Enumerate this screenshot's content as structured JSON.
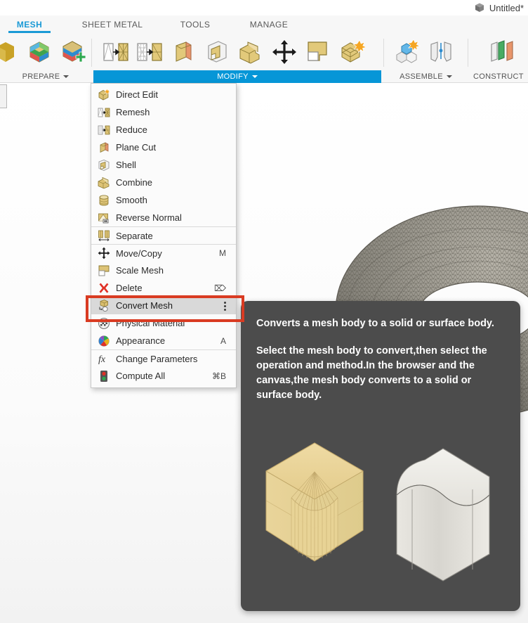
{
  "titlebar": {
    "document_name": "Untitled*",
    "doc_icon": "cube-icon"
  },
  "tabs": [
    {
      "label": "MESH",
      "active": true
    },
    {
      "label": "SHEET METAL",
      "active": false
    },
    {
      "label": "TOOLS",
      "active": false
    },
    {
      "label": "MANAGE",
      "active": false
    }
  ],
  "panels": [
    {
      "label": "PREPARE",
      "has_caret": true,
      "active": false
    },
    {
      "label": "MODIFY",
      "has_caret": true,
      "active": true
    },
    {
      "label": "ASSEMBLE",
      "has_caret": true,
      "active": false
    },
    {
      "label": "CONSTRUCT",
      "has_caret": false,
      "active": false
    }
  ],
  "menu": {
    "items": [
      {
        "label": "Direct Edit",
        "shortcut": "",
        "icon": "direct-edit-icon",
        "separator_above": false,
        "selected": false
      },
      {
        "label": "Remesh",
        "shortcut": "",
        "icon": "remesh-icon",
        "separator_above": false,
        "selected": false
      },
      {
        "label": "Reduce",
        "shortcut": "",
        "icon": "reduce-icon",
        "separator_above": false,
        "selected": false
      },
      {
        "label": "Plane Cut",
        "shortcut": "",
        "icon": "plane-cut-icon",
        "separator_above": false,
        "selected": false
      },
      {
        "label": "Shell",
        "shortcut": "",
        "icon": "shell-icon",
        "separator_above": false,
        "selected": false
      },
      {
        "label": "Combine",
        "shortcut": "",
        "icon": "combine-icon",
        "separator_above": false,
        "selected": false
      },
      {
        "label": "Smooth",
        "shortcut": "",
        "icon": "smooth-icon",
        "separator_above": false,
        "selected": false
      },
      {
        "label": "Reverse Normal",
        "shortcut": "",
        "icon": "reverse-normal-icon",
        "separator_above": false,
        "selected": false
      },
      {
        "label": "Separate",
        "shortcut": "",
        "icon": "separate-icon",
        "separator_above": true,
        "selected": false
      },
      {
        "label": "Move/Copy",
        "shortcut": "M",
        "icon": "move-copy-icon",
        "separator_above": true,
        "selected": false
      },
      {
        "label": "Scale Mesh",
        "shortcut": "",
        "icon": "scale-mesh-icon",
        "separator_above": false,
        "selected": false
      },
      {
        "label": "Delete",
        "shortcut": "⌦",
        "icon": "delete-icon",
        "separator_above": false,
        "selected": false
      },
      {
        "label": "Convert Mesh",
        "shortcut": "",
        "icon": "convert-mesh-icon",
        "separator_above": false,
        "selected": true
      },
      {
        "label": "Physical Material",
        "shortcut": "",
        "icon": "physical-material-icon",
        "separator_above": false,
        "selected": false
      },
      {
        "label": "Appearance",
        "shortcut": "A",
        "icon": "appearance-icon",
        "separator_above": false,
        "selected": false
      },
      {
        "label": "Change Parameters",
        "shortcut": "",
        "icon": "change-parameters-icon",
        "separator_above": true,
        "selected": false
      },
      {
        "label": "Compute All",
        "shortcut": "⌘B",
        "icon": "compute-all-icon",
        "separator_above": false,
        "selected": false
      }
    ]
  },
  "annotation": {
    "color": "#d93b22",
    "target": "Convert Mesh"
  },
  "tooltip": {
    "paragraph_1": "Converts a mesh body to a solid or surface body.",
    "paragraph_2": "Select the mesh body to convert,then select the operation and method.In the browser and the canvas,the mesh body converts to a solid or surface body.",
    "background": "#4c4c4c",
    "illustration": {
      "left": {
        "name": "mesh-body-faceted-cube",
        "color": "#e8d191"
      },
      "right": {
        "name": "solid-body-smooth-cube",
        "color": "#e6e4df"
      }
    }
  },
  "canvas": {
    "object": "mesh-torus",
    "color": "#7d7a73"
  }
}
